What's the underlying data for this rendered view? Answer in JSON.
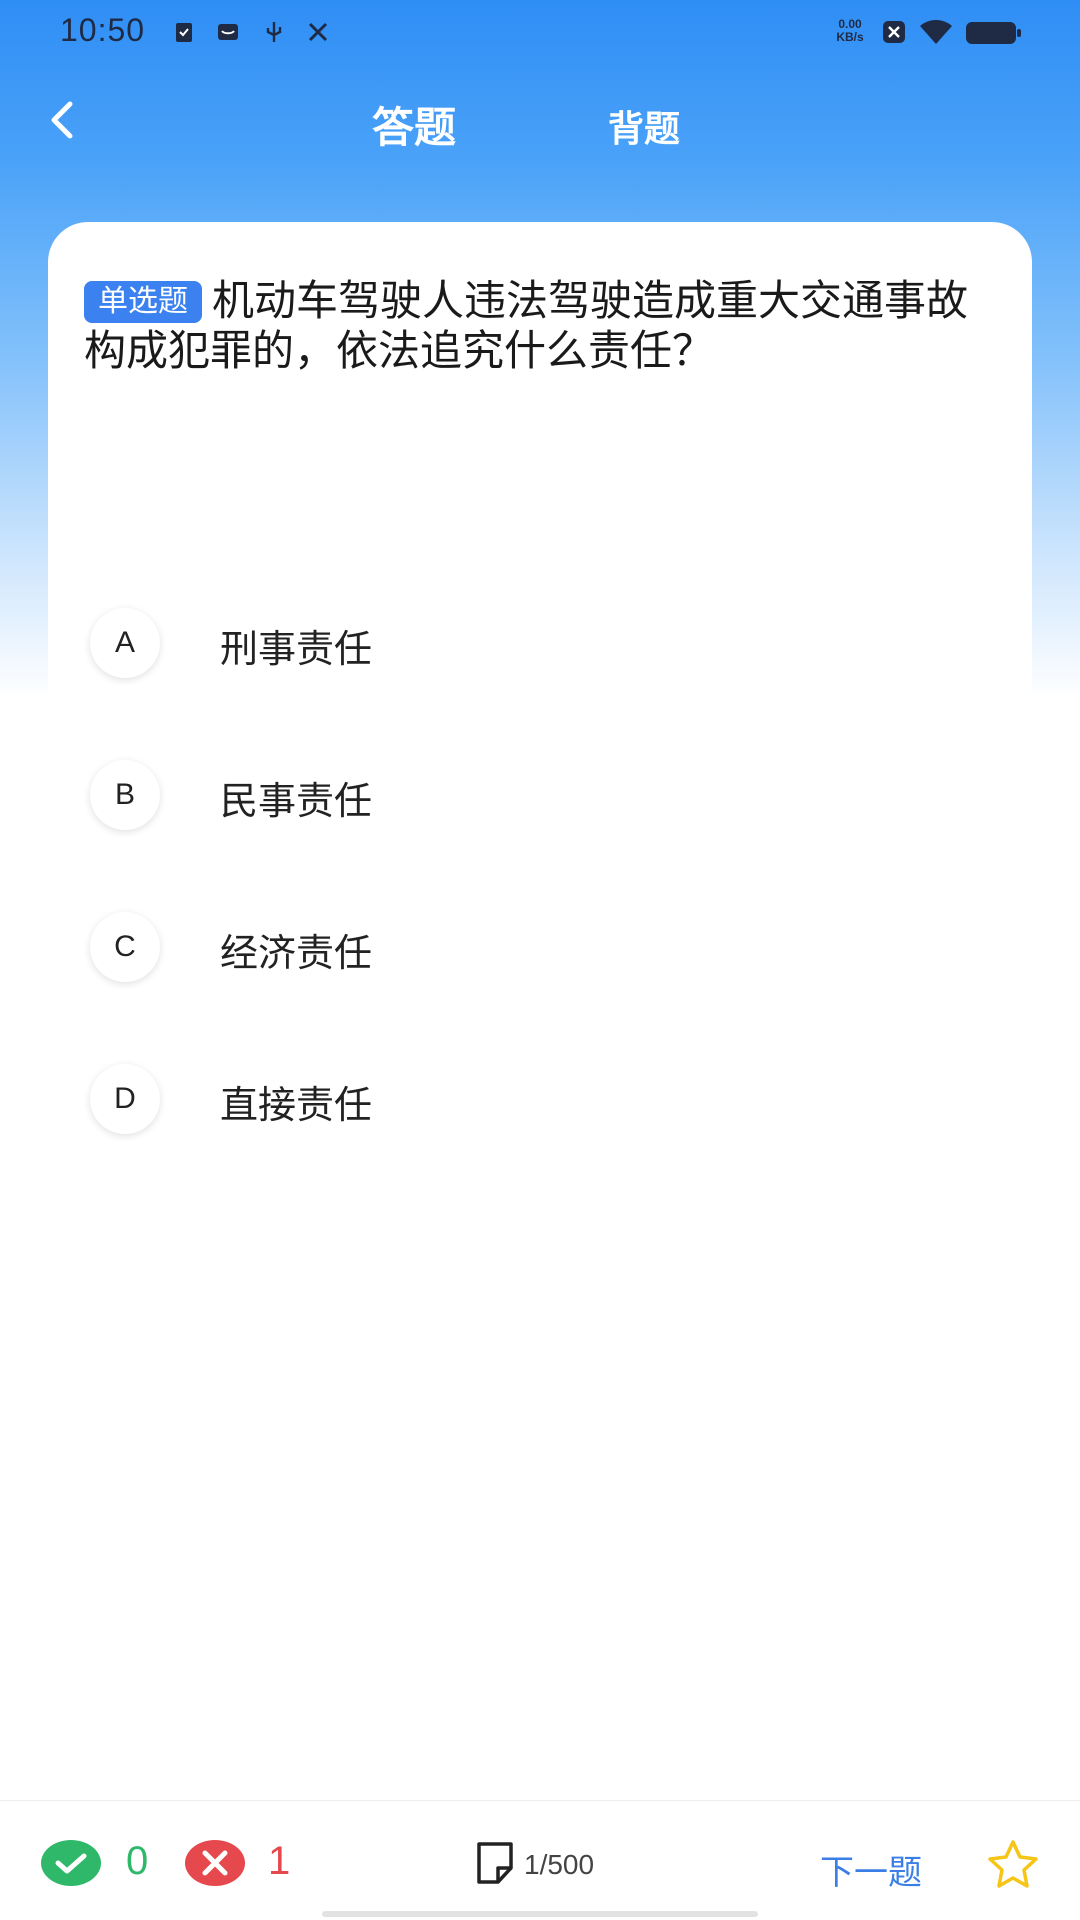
{
  "status_bar": {
    "time": "10:50",
    "net_speed_value": "0.00",
    "net_speed_unit": "KB/s",
    "icons": [
      "clipboard-icon",
      "mail-icon",
      "usb-icon",
      "tools-icon",
      "close-box-icon",
      "wifi-icon",
      "battery-icon"
    ]
  },
  "header": {
    "tabs": [
      {
        "label": "答题",
        "active": true
      },
      {
        "label": "背题",
        "active": false
      }
    ]
  },
  "question": {
    "type_tag": "单选题",
    "text": "机动车驾驶人违法驾驶造成重大交通事故构成犯罪的，依法追究什么责任？",
    "options": [
      {
        "letter": "A",
        "text": "刑事责任"
      },
      {
        "letter": "B",
        "text": "民事责任"
      },
      {
        "letter": "C",
        "text": "经济责任"
      },
      {
        "letter": "D",
        "text": "直接责任"
      }
    ]
  },
  "footer": {
    "correct_count": "0",
    "wrong_count": "1",
    "progress": "1/500",
    "next_label": "下一题"
  },
  "colors": {
    "accent": "#3b82f0",
    "correct": "#2fb86a",
    "wrong": "#e5484d",
    "star": "#f5c518"
  }
}
